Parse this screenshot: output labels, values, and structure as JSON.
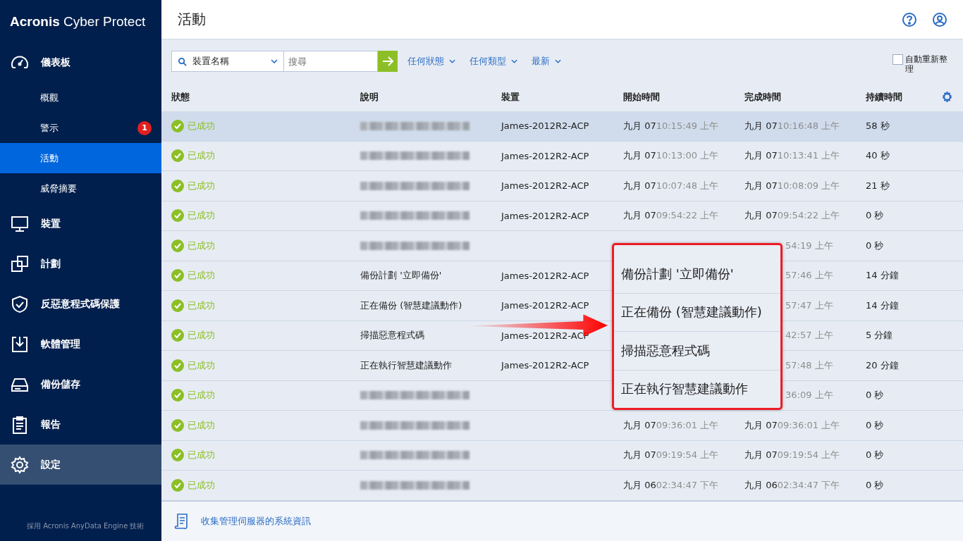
{
  "brand": {
    "name": "Acronis",
    "product": "Cyber Protect"
  },
  "sidebar": {
    "items": [
      {
        "label": "儀表板",
        "kind": "main",
        "selected": false,
        "hovered": false
      },
      {
        "label": "概觀",
        "kind": "sub",
        "selected": false,
        "hovered": false
      },
      {
        "label": "警示",
        "kind": "sub",
        "selected": false,
        "hovered": false,
        "badge": "1"
      },
      {
        "label": "活動",
        "kind": "sub",
        "selected": true,
        "hovered": false
      },
      {
        "label": "威脅摘要",
        "kind": "sub",
        "selected": false,
        "hovered": false
      },
      {
        "label": "裝置",
        "kind": "main",
        "selected": false,
        "hovered": false
      },
      {
        "label": "計劃",
        "kind": "main",
        "selected": false,
        "hovered": false
      },
      {
        "label": "反惡意程式碼保護",
        "kind": "main",
        "selected": false,
        "hovered": false
      },
      {
        "label": "軟體管理",
        "kind": "main",
        "selected": false,
        "hovered": false
      },
      {
        "label": "備份儲存",
        "kind": "main",
        "selected": false,
        "hovered": false
      },
      {
        "label": "報告",
        "kind": "main",
        "selected": false,
        "hovered": false
      },
      {
        "label": "設定",
        "kind": "main",
        "selected": false,
        "hovered": true
      }
    ],
    "footer": "採用 Acronis AnyData Engine 技術"
  },
  "page_title": "活動",
  "toolbar": {
    "search_scope": "裝置名稱",
    "search": {
      "placeholder": "搜尋"
    },
    "filters": [
      "任何狀態",
      "任何類型",
      "最新"
    ],
    "auto_refresh": {
      "label": "自動重新整理",
      "checked": false
    }
  },
  "table": {
    "columns": [
      "狀態",
      "說明",
      "裝置",
      "開始時間",
      "完成時間",
      "持續時間"
    ],
    "rows": [
      {
        "selected": true,
        "status": "已成功",
        "description_blurred": true,
        "device": "James-2012R2-ACP",
        "start": {
          "date": "九月 07",
          "time": "10:15:49 上午"
        },
        "finish": {
          "date": "九月 07",
          "time": "10:16:48 上午"
        },
        "duration": "58 秒"
      },
      {
        "selected": false,
        "status": "已成功",
        "description_blurred": true,
        "device": "James-2012R2-ACP",
        "start": {
          "date": "九月 07",
          "time": "10:13:00 上午"
        },
        "finish": {
          "date": "九月 07",
          "time": "10:13:41 上午"
        },
        "duration": "40 秒"
      },
      {
        "selected": false,
        "status": "已成功",
        "description_blurred": true,
        "device": "James-2012R2-ACP",
        "start": {
          "date": "九月 07",
          "time": "10:07:48 上午"
        },
        "finish": {
          "date": "九月 07",
          "time": "10:08:09 上午"
        },
        "duration": "21 秒"
      },
      {
        "selected": false,
        "status": "已成功",
        "description_blurred": true,
        "device": "James-2012R2-ACP",
        "start": {
          "date": "九月 07",
          "time": "09:54:22 上午"
        },
        "finish": {
          "date": "九月 07",
          "time": "09:54:22 上午"
        },
        "duration": "0 秒"
      },
      {
        "selected": false,
        "status": "已成功",
        "description_blurred": true,
        "finish": {
          "time": "54:19 上午"
        },
        "duration": "0 秒"
      },
      {
        "selected": false,
        "status": "已成功",
        "description": "備份計劃 '立即備份'",
        "device": "James-2012R2-ACP",
        "finish": {
          "time": "57:46 上午"
        },
        "duration": "14 分鐘"
      },
      {
        "selected": false,
        "status": "已成功",
        "description": "正在備份 (智慧建議動作)",
        "device": "James-2012R2-ACP",
        "finish": {
          "time": "57:47 上午"
        },
        "duration": "14 分鐘"
      },
      {
        "selected": false,
        "status": "已成功",
        "description": "掃描惡意程式碼",
        "device": "James-2012R2-ACP",
        "finish": {
          "time": "42:57 上午"
        },
        "duration": "5 分鐘"
      },
      {
        "selected": false,
        "status": "已成功",
        "description": "正在執行智慧建議動作",
        "device": "James-2012R2-ACP",
        "finish": {
          "time": "57:48 上午"
        },
        "duration": "20 分鐘"
      },
      {
        "selected": false,
        "status": "已成功",
        "description_blurred": true,
        "finish": {
          "time": "36:09 上午"
        },
        "duration": "0 秒"
      },
      {
        "selected": false,
        "status": "已成功",
        "description_blurred": true,
        "start": {
          "date": "九月 07",
          "time": "09:36:01 上午"
        },
        "finish": {
          "date": "九月 07",
          "time": "09:36:01 上午"
        },
        "duration": "0 秒"
      },
      {
        "selected": false,
        "status": "已成功",
        "description_blurred": true,
        "start": {
          "date": "九月 07",
          "time": "09:19:54 上午"
        },
        "finish": {
          "date": "九月 07",
          "time": "09:19:54 上午"
        },
        "duration": "0 秒"
      },
      {
        "selected": false,
        "status": "已成功",
        "description_blurred": true,
        "start": {
          "date": "九月 06",
          "time": "02:34:47 下午"
        },
        "finish": {
          "date": "九月 06",
          "time": "02:34:47 下午"
        },
        "duration": "0 秒"
      }
    ]
  },
  "footer_link": "收集管理伺服器的系統資訊",
  "callout": {
    "lines": [
      "備份計劃 '立即備份'",
      "正在備份 (智慧建議動作)",
      "掃描惡意程式碼",
      "正在執行智慧建議動作"
    ]
  }
}
